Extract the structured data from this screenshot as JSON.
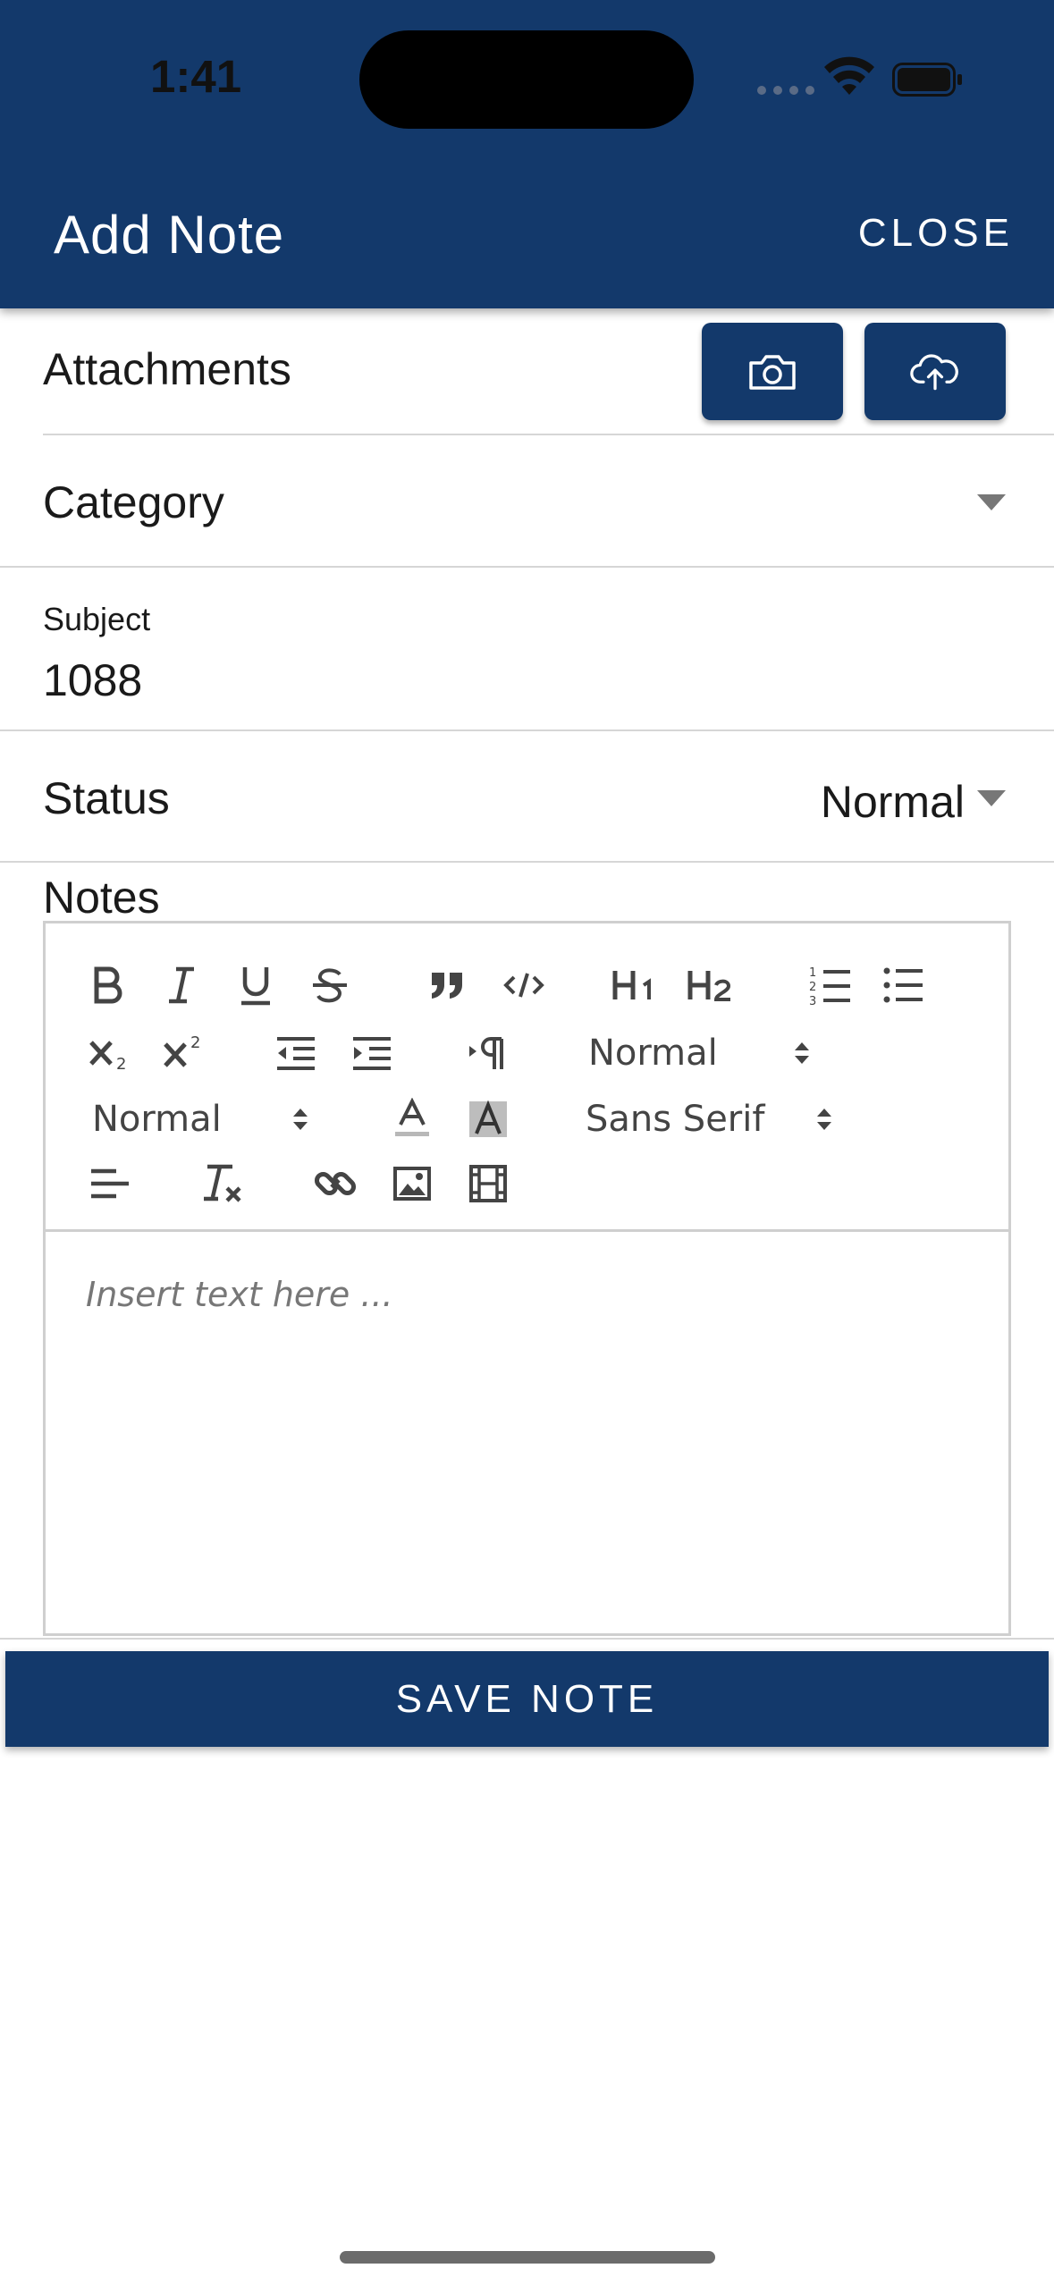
{
  "status_bar": {
    "time": "1:41"
  },
  "header": {
    "title": "Add Note",
    "close_label": "CLOSE"
  },
  "form": {
    "attachments_label": "Attachments",
    "category_label": "Category",
    "subject_label": "Subject",
    "subject_value": "1088",
    "status_label": "Status",
    "status_value": "Normal",
    "notes_label": "Notes"
  },
  "editor": {
    "toolbar": {
      "heading_select": "Normal",
      "size_select": "Normal",
      "font_select": "Sans Serif"
    },
    "placeholder": "Insert text here ..."
  },
  "save_label": "SAVE NOTE",
  "colors": {
    "header_bg": "#13396b",
    "button_bg": "#13396b"
  },
  "icons": [
    "camera-icon",
    "cloud-upload-icon",
    "chevron-down-icon",
    "wifi-icon",
    "battery-icon"
  ]
}
